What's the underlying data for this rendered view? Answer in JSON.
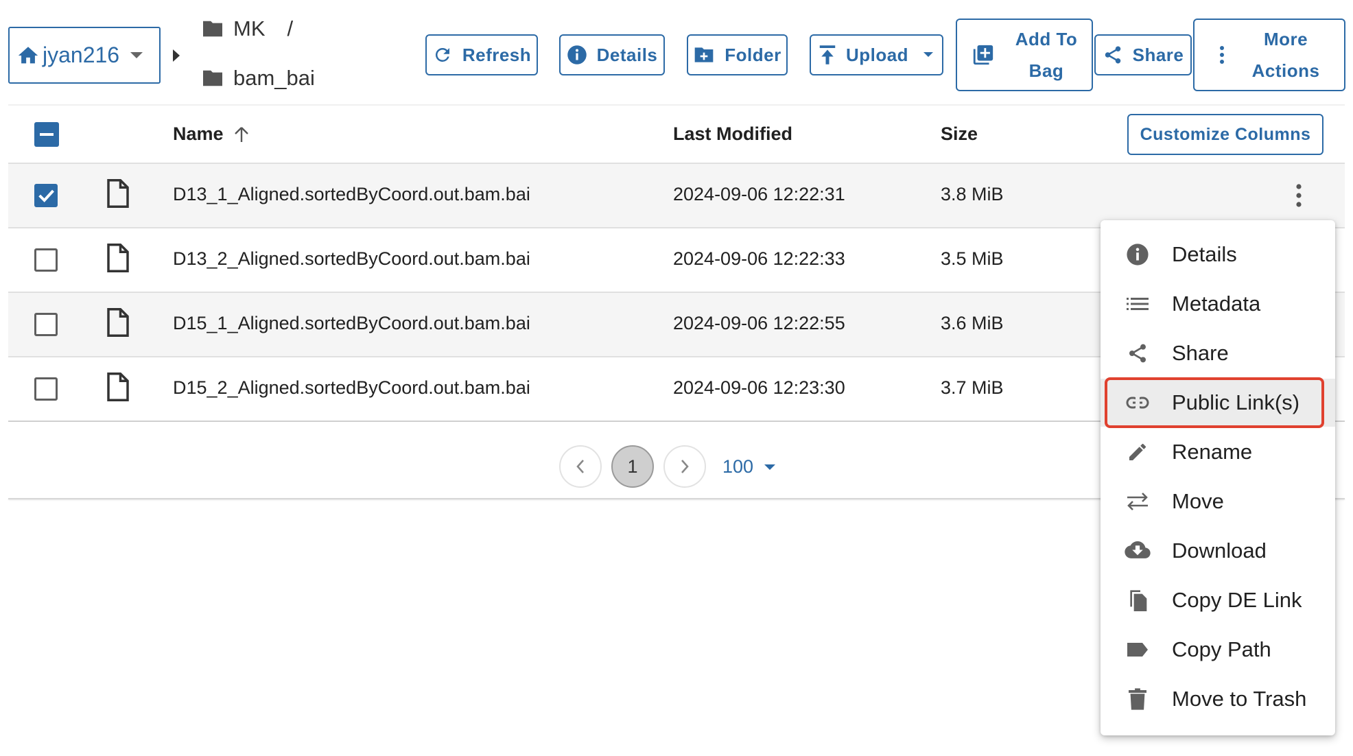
{
  "toolbar": {
    "user": "jyan216",
    "breadcrumb": [
      "MK",
      "bam_bai"
    ],
    "breadcrumb_sep": "/",
    "refresh": "Refresh",
    "details": "Details",
    "folder": "Folder",
    "upload": "Upload",
    "add_to_bag": [
      "Add To",
      "Bag"
    ],
    "share": "Share",
    "more_actions": [
      "More",
      "Actions"
    ]
  },
  "table": {
    "columns": {
      "name": "Name",
      "last_modified": "Last Modified",
      "size": "Size"
    },
    "customize_columns": "Customize Columns",
    "rows": [
      {
        "name": "D13_1_Aligned.sortedByCoord.out.bam.bai",
        "modified": "2024-09-06 12:22:31",
        "size": "3.8 MiB",
        "checked": true
      },
      {
        "name": "D13_2_Aligned.sortedByCoord.out.bam.bai",
        "modified": "2024-09-06 12:22:33",
        "size": "3.5 MiB",
        "checked": false
      },
      {
        "name": "D15_1_Aligned.sortedByCoord.out.bam.bai",
        "modified": "2024-09-06 12:22:55",
        "size": "3.6 MiB",
        "checked": false
      },
      {
        "name": "D15_2_Aligned.sortedByCoord.out.bam.bai",
        "modified": "2024-09-06 12:23:30",
        "size": "3.7 MiB",
        "checked": false
      }
    ]
  },
  "pagination": {
    "page": "1",
    "page_size": "100"
  },
  "context_menu": {
    "items": [
      {
        "label": "Details",
        "icon": "info-icon"
      },
      {
        "label": "Metadata",
        "icon": "list-icon"
      },
      {
        "label": "Share",
        "icon": "share-icon"
      },
      {
        "label": "Public Link(s)",
        "icon": "link-icon"
      },
      {
        "label": "Rename",
        "icon": "pencil-icon"
      },
      {
        "label": "Move",
        "icon": "swap-icon"
      },
      {
        "label": "Download",
        "icon": "cloud-download-icon"
      },
      {
        "label": "Copy DE Link",
        "icon": "copy-icon"
      },
      {
        "label": "Copy Path",
        "icon": "label-icon"
      },
      {
        "label": "Move to Trash",
        "icon": "trash-icon"
      }
    ],
    "highlighted": "Public Link(s)"
  },
  "colors": {
    "accent": "#2c6aa6",
    "highlight_border": "#e0412f"
  }
}
